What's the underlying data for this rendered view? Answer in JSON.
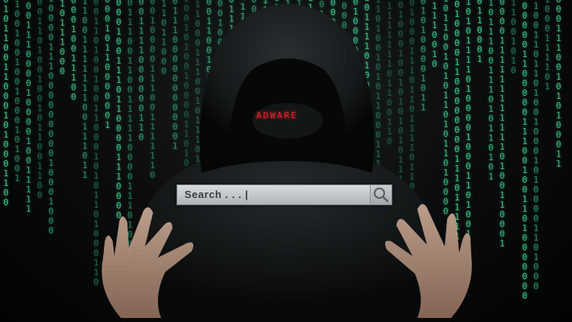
{
  "overlay": {
    "label": "ADWARE",
    "search": {
      "placeholder": "Search . . . |"
    }
  },
  "colors": {
    "matrix_green": "#3ec98a",
    "alert_red": "#e8222c",
    "search_bar": "#c4c9cc"
  },
  "icons": {
    "search_button": "magnifier-icon"
  }
}
